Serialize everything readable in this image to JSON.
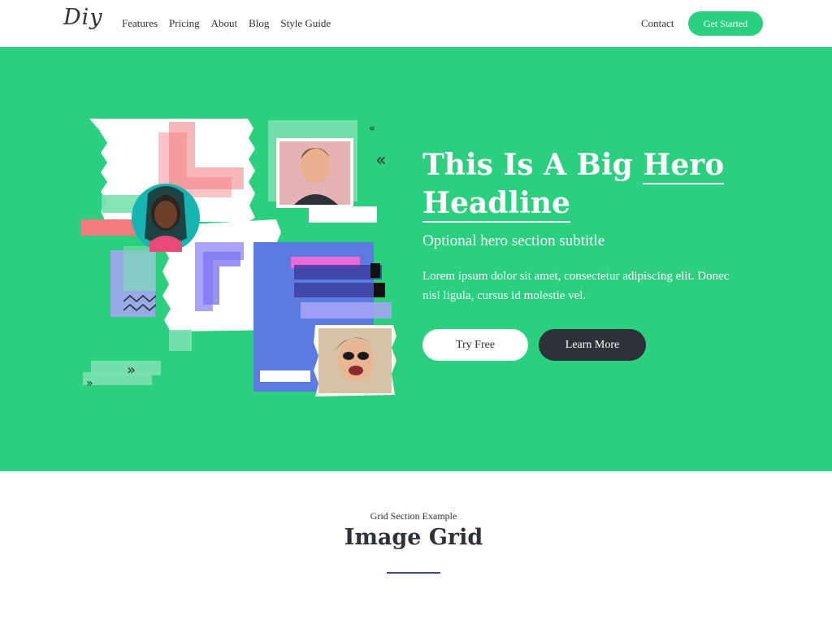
{
  "header": {
    "logo": "Diy",
    "nav": [
      "Features",
      "Pricing",
      "About",
      "Blog",
      "Style Guide"
    ],
    "contact": "Contact",
    "cta": "Get Started"
  },
  "hero": {
    "headline_part1": "This Is A Big ",
    "headline_part2": "Hero",
    "headline_part3": "Headline",
    "subtitle": "Optional hero section subtitle",
    "body": "Lorem ipsum dolor sit amet, consectetur adipiscing elit. Donec nisl ligula, cursus id molestie vel.",
    "primary_button": "Try Free",
    "secondary_button": "Learn More"
  },
  "grid_section": {
    "eyebrow": "Grid Section Example",
    "title": "Image Grid"
  },
  "colors": {
    "brand_green": "#2bd07f",
    "dark": "#2d3138",
    "accent_blue": "#5b7be0",
    "accent_pink": "#f37b7f",
    "accent_purple": "#a9a4f7"
  }
}
